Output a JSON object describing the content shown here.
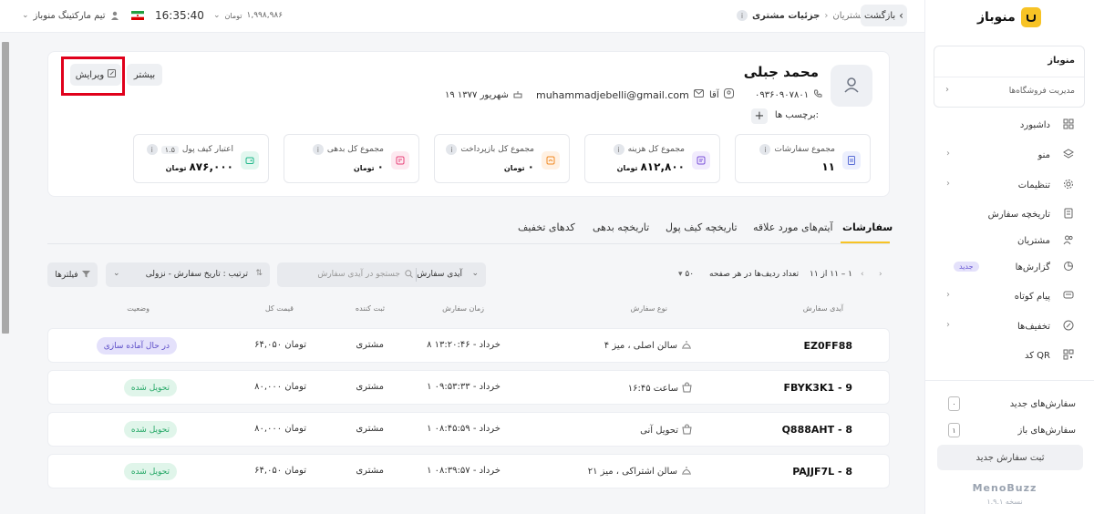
{
  "topbar": {
    "back": "بازگشت",
    "breadcrumb_parent": "مشتریان",
    "breadcrumb_sep": "›",
    "breadcrumb_current": "جزئیات مشتری",
    "balance_value": "۱,۹۹۸,۹۸۶",
    "balance_unit": "تومان",
    "time": "16:35:40",
    "team": "تیم مارکتینگ منوباز"
  },
  "sidebar": {
    "brand": "منوباز",
    "store_name": "منوباز",
    "store_manage": "مدیریت فروشگاه‌ها",
    "items": [
      {
        "label": "داشبورد",
        "icon": "dashboard-icon",
        "chevron": false
      },
      {
        "label": "منو",
        "icon": "layers-icon",
        "chevron": true
      },
      {
        "label": "تنظیمات",
        "icon": "gear-icon",
        "chevron": true
      },
      {
        "label": "تاریخچه سفارش",
        "icon": "receipt-icon",
        "chevron": false
      },
      {
        "label": "مشتریان",
        "icon": "users-icon",
        "chevron": false
      },
      {
        "label": "گزارش‌ها",
        "icon": "pie-chart-icon",
        "chevron": false,
        "badge": "جدید"
      },
      {
        "label": "پیام کوتاه",
        "icon": "message-icon",
        "chevron": true
      },
      {
        "label": "تخفیف‌ها",
        "icon": "discount-icon",
        "chevron": true
      },
      {
        "label": "کد QR",
        "icon": "qr-icon",
        "chevron": false
      }
    ],
    "new_orders_label": "سفارش‌های جدید",
    "new_orders_count": "۰",
    "open_orders_label": "سفارش‌های باز",
    "open_orders_count": "۱",
    "new_order_button": "ثبت سفارش جدید",
    "footer_brand": "MenoBuzz",
    "footer_version": "نسخه ۱.۹.۱"
  },
  "customer": {
    "name": "محمد جبلی",
    "phone": "۰۹۳۶۰۹۰۷۸۰۱",
    "title": "آقا",
    "email": "muhammadjebelli@gmail.com",
    "birthday": "۱۹ شهریور ۱۳۷۷",
    "tags_label": "برچسب ها:",
    "tag_add": "+",
    "more_button": "بیشتر",
    "edit_button": "ویرایش"
  },
  "stats": [
    {
      "title": "مجموع سفارشات",
      "value": "۱۱",
      "unit": "",
      "color": "#5b6fd6",
      "bg": "#eceffd",
      "icon": "document-icon"
    },
    {
      "title": "مجموع کل هزینه",
      "value": "۸۱۲,۸۰۰",
      "unit": "تومان",
      "color": "#7b52d9",
      "bg": "#f1ebfd",
      "icon": "invoice-icon"
    },
    {
      "title": "مجموع کل بازپرداخت",
      "value": "۰",
      "unit": "تومان",
      "color": "#f08a24",
      "bg": "#fff1e3",
      "icon": "refund-icon"
    },
    {
      "title": "مجموع کل بدهی",
      "value": "۰",
      "unit": "تومان",
      "color": "#e8447a",
      "bg": "#fde9f0",
      "icon": "debt-icon"
    },
    {
      "title": "اعتبار کیف پول",
      "badge": "۱.۵",
      "value": "۸۷۶,۰۰۰",
      "unit": "تومان",
      "color": "#1fb78a",
      "bg": "#e2f7ef",
      "icon": "wallet-icon"
    }
  ],
  "tabs": [
    "سفارشات",
    "آیتم‌های مورد علاقه",
    "تاریخچه کیف پول",
    "تاریخچه بدهی",
    "کدهای تخفیف"
  ],
  "toolbar": {
    "filter": "فیلترها",
    "sort": "ترتیب : تاریخ سفارش - نزولی",
    "search_placeholder": "جستجو در آیدی سفارش",
    "search_field": "آیدی سفارش",
    "rows_per_page_label": "تعداد ردیف‌ها در هر صفحه",
    "rows_per_page_value": "۵۰",
    "range": "۱ – ۱۱ از ۱۱"
  },
  "table": {
    "headers": [
      "آیدی سفارش",
      "نوع سفارش",
      "زمان سفارش",
      "ثبت کننده",
      "قیمت کل",
      "وضعیت"
    ],
    "rows": [
      {
        "id": "EZ0FF88",
        "type": "سالن اصلی ، میز ۴",
        "type_icon": "dine-in-icon",
        "time": "۸ خرداد - ۱۳:۲۰:۴۶",
        "by": "مشتری",
        "price": "۶۴,۰۵۰ تومان",
        "status": "در حال آماده سازی",
        "status_kind": "preparing"
      },
      {
        "id": "FBYK3K1 - 9",
        "type": "ساعت ۱۶:۴۵",
        "type_icon": "bag-icon",
        "time": "۱ خرداد - ۰۹:۵۳:۳۳",
        "by": "مشتری",
        "price": "۸۰,۰۰۰ تومان",
        "status": "تحویل شده",
        "status_kind": "delivered"
      },
      {
        "id": "Q888AHT - 8",
        "type": "تحویل آنی",
        "type_icon": "bag-icon",
        "time": "۱ خرداد - ۰۸:۴۵:۵۹",
        "by": "مشتری",
        "price": "۸۰,۰۰۰ تومان",
        "status": "تحویل شده",
        "status_kind": "delivered"
      },
      {
        "id": "PAJJF7L - 8",
        "type": "سالن اشتراکی ، میز ۲۱",
        "type_icon": "dine-in-icon",
        "time": "۱ خرداد - ۰۸:۳۹:۵۷",
        "by": "مشتری",
        "price": "۶۴,۰۵۰ تومان",
        "status": "تحویل شده",
        "status_kind": "delivered"
      }
    ]
  },
  "colors": {
    "accent": "#f7c325",
    "highlight": "#e0001b"
  }
}
